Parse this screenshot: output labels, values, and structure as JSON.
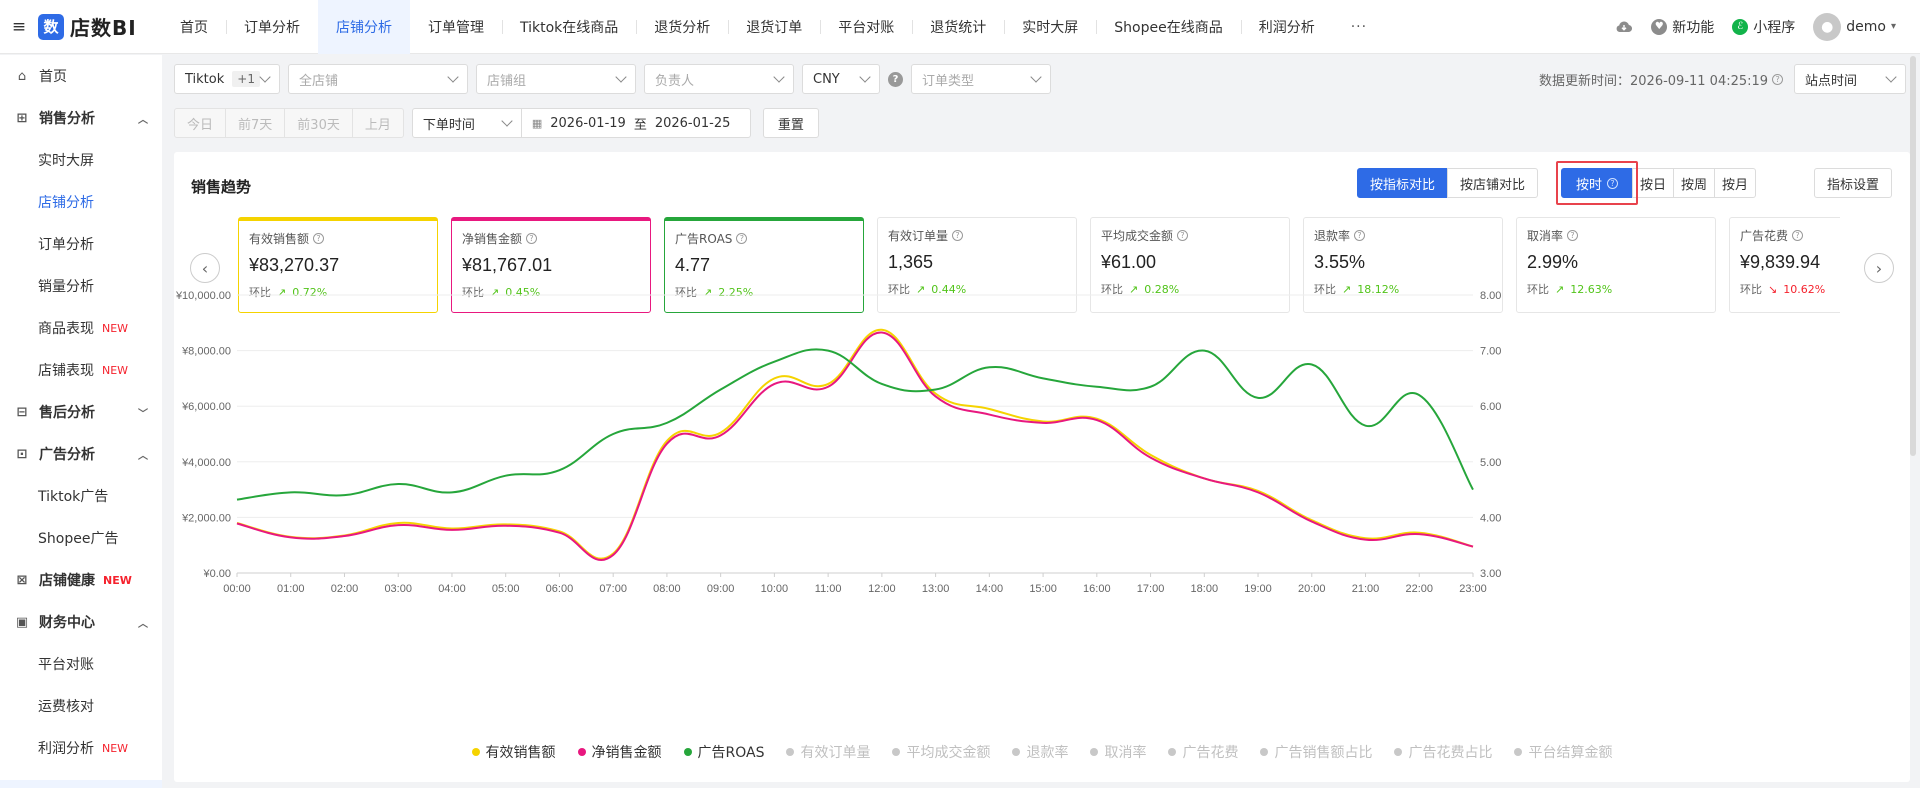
{
  "app": {
    "logo_text": "店数BI",
    "logo_glyph": "数"
  },
  "topnav": {
    "tabs": [
      {
        "label": "首页",
        "active": false
      },
      {
        "label": "订单分析",
        "active": false
      },
      {
        "label": "店铺分析",
        "active": true
      },
      {
        "label": "订单管理",
        "active": false
      },
      {
        "label": "Tiktok在线商品",
        "active": false
      },
      {
        "label": "退货分析",
        "active": false
      },
      {
        "label": "退货订单",
        "active": false
      },
      {
        "label": "平台对账",
        "active": false
      },
      {
        "label": "退货统计",
        "active": false
      },
      {
        "label": "实时大屏",
        "active": false
      },
      {
        "label": "Shopee在线商品",
        "active": false
      },
      {
        "label": "利润分析",
        "active": false
      }
    ],
    "more": "···",
    "right": {
      "new_feature": "新功能",
      "mini_program": "小程序",
      "user": "demo"
    }
  },
  "sidebar": {
    "items": [
      {
        "type": "item",
        "icon": "home-icon",
        "glyph": "⌂",
        "label": "首页"
      },
      {
        "type": "group",
        "icon": "sales-icon",
        "glyph": "⊞",
        "label": "销售分析",
        "open": true
      },
      {
        "type": "sub",
        "label": "实时大屏"
      },
      {
        "type": "sub",
        "label": "店铺分析",
        "active": true
      },
      {
        "type": "sub",
        "label": "订单分析"
      },
      {
        "type": "sub",
        "label": "销量分析"
      },
      {
        "type": "sub",
        "label": "商品表现",
        "badge": "NEW"
      },
      {
        "type": "sub",
        "label": "店铺表现",
        "badge": "NEW"
      },
      {
        "type": "group",
        "icon": "after-sale-icon",
        "glyph": "⊟",
        "label": "售后分析",
        "open": false
      },
      {
        "type": "group",
        "icon": "ads-icon",
        "glyph": "⊡",
        "label": "广告分析",
        "open": true
      },
      {
        "type": "sub",
        "label": "Tiktok广告"
      },
      {
        "type": "sub",
        "label": "Shopee广告"
      },
      {
        "type": "group",
        "icon": "shop-health-icon",
        "glyph": "⊠",
        "label": "店铺健康",
        "badge": "NEW",
        "nochev": true
      },
      {
        "type": "group",
        "icon": "finance-icon",
        "glyph": "▣",
        "label": "财务中心",
        "open": true
      },
      {
        "type": "sub",
        "label": "平台对账"
      },
      {
        "type": "sub",
        "label": "运费核对"
      },
      {
        "type": "sub",
        "label": "利润分析",
        "badge": "NEW"
      }
    ]
  },
  "filters": {
    "platform": "Tiktok",
    "platform_extra": "+1",
    "shop_placeholder": "全店铺",
    "shop_group_placeholder": "店铺组",
    "owner_placeholder": "负责人",
    "currency": "CNY",
    "help_glyph": "?",
    "order_type_placeholder": "订单类型",
    "update_label": "数据更新时间：2026-09-11 04:25:19",
    "timezone": "站点时间",
    "quick": [
      "今日",
      "前7天",
      "前30天",
      "上月"
    ],
    "time_field": "下单时间",
    "date_from": "2026-01-19",
    "date_sep": "至",
    "date_to": "2026-01-25",
    "reset": "重置"
  },
  "card": {
    "title": "销售趋势",
    "compare_modes": [
      "按指标对比",
      "按店铺对比"
    ],
    "granularity": [
      "按时",
      "按日",
      "按周",
      "按月"
    ],
    "settings": "指标设置"
  },
  "metrics": [
    {
      "label": "有效销售额",
      "value": "¥83,270.37",
      "comp_label": "环比",
      "comp": "0.72%",
      "trend": "up",
      "selected": "y"
    },
    {
      "label": "净销售金额",
      "value": "¥81,767.01",
      "comp_label": "环比",
      "comp": "0.45%",
      "trend": "up",
      "selected": "p"
    },
    {
      "label": "广告ROAS",
      "value": "4.77",
      "comp_label": "环比",
      "comp": "2.25%",
      "trend": "up",
      "selected": "g"
    },
    {
      "label": "有效订单量",
      "value": "1,365",
      "comp_label": "环比",
      "comp": "0.44%",
      "trend": "up",
      "selected": ""
    },
    {
      "label": "平均成交金额",
      "value": "¥61.00",
      "comp_label": "环比",
      "comp": "0.28%",
      "trend": "up",
      "selected": ""
    },
    {
      "label": "退款率",
      "value": "3.55%",
      "comp_label": "环比",
      "comp": "18.12%",
      "trend": "up",
      "selected": ""
    },
    {
      "label": "取消率",
      "value": "2.99%",
      "comp_label": "环比",
      "comp": "12.63%",
      "trend": "up",
      "selected": ""
    },
    {
      "label": "广告花费",
      "value": "¥9,839.94",
      "comp_label": "环比",
      "comp": "10.62%",
      "trend": "down",
      "selected": ""
    }
  ],
  "chart_data": {
    "type": "line",
    "x": [
      "00:00",
      "01:00",
      "02:00",
      "03:00",
      "04:00",
      "05:00",
      "06:00",
      "07:00",
      "08:00",
      "09:00",
      "10:00",
      "11:00",
      "12:00",
      "13:00",
      "14:00",
      "15:00",
      "16:00",
      "17:00",
      "18:00",
      "19:00",
      "20:00",
      "21:00",
      "22:00",
      "23:00"
    ],
    "y_left_ticks": [
      "¥10,000.00",
      "¥8,000.00",
      "¥6,000.00",
      "¥4,000.00",
      "¥2,000.00",
      "¥0.00"
    ],
    "y_left_range": [
      0,
      10000
    ],
    "y_right_ticks": [
      "8.00",
      "7.00",
      "6.00",
      "5.00",
      "4.00",
      "3.00"
    ],
    "y_right_range": [
      3,
      8
    ],
    "series": [
      {
        "name": "有效销售额",
        "axis": "left",
        "color": "#f5d300",
        "values": [
          1800,
          1300,
          1350,
          1800,
          1600,
          1750,
          1500,
          700,
          4750,
          5050,
          7000,
          6800,
          8750,
          6450,
          5900,
          5450,
          5550,
          4250,
          3400,
          2950,
          1900,
          1250,
          1450,
          950
        ]
      },
      {
        "name": "净销售金额",
        "axis": "left",
        "color": "#e8187f",
        "values": [
          1780,
          1280,
          1330,
          1720,
          1550,
          1700,
          1450,
          650,
          4650,
          4950,
          6800,
          6700,
          8650,
          6350,
          5700,
          5400,
          5500,
          4150,
          3400,
          2900,
          1850,
          1200,
          1400,
          950
        ]
      },
      {
        "name": "广告ROAS",
        "axis": "right",
        "color": "#26a63b",
        "values": [
          4.32,
          4.45,
          4.4,
          4.6,
          4.45,
          4.75,
          4.85,
          5.5,
          5.7,
          6.3,
          6.8,
          7.0,
          6.4,
          6.3,
          6.7,
          6.5,
          6.35,
          6.35,
          7.0,
          6.15,
          6.75,
          5.65,
          6.2,
          4.5
        ]
      }
    ],
    "legend": [
      {
        "name": "有效销售额",
        "color": "#f5d300",
        "on": true
      },
      {
        "name": "净销售金额",
        "color": "#e8187f",
        "on": true
      },
      {
        "name": "广告ROAS",
        "color": "#26a63b",
        "on": true
      },
      {
        "name": "有效订单量",
        "color": "#c8c8c8",
        "on": false
      },
      {
        "name": "平均成交金额",
        "color": "#c8c8c8",
        "on": false
      },
      {
        "name": "退款率",
        "color": "#c8c8c8",
        "on": false
      },
      {
        "name": "取消率",
        "color": "#c8c8c8",
        "on": false
      },
      {
        "name": "广告花费",
        "color": "#c8c8c8",
        "on": false
      },
      {
        "name": "广告销售额占比",
        "color": "#c8c8c8",
        "on": false
      },
      {
        "name": "广告花费占比",
        "color": "#c8c8c8",
        "on": false
      },
      {
        "name": "平台结算金额",
        "color": "#c8c8c8",
        "on": false
      }
    ],
    "grid": true,
    "legend_position": "bottom"
  },
  "colors": {
    "accent": "#2e6be6",
    "highlight": "#e8434c"
  }
}
